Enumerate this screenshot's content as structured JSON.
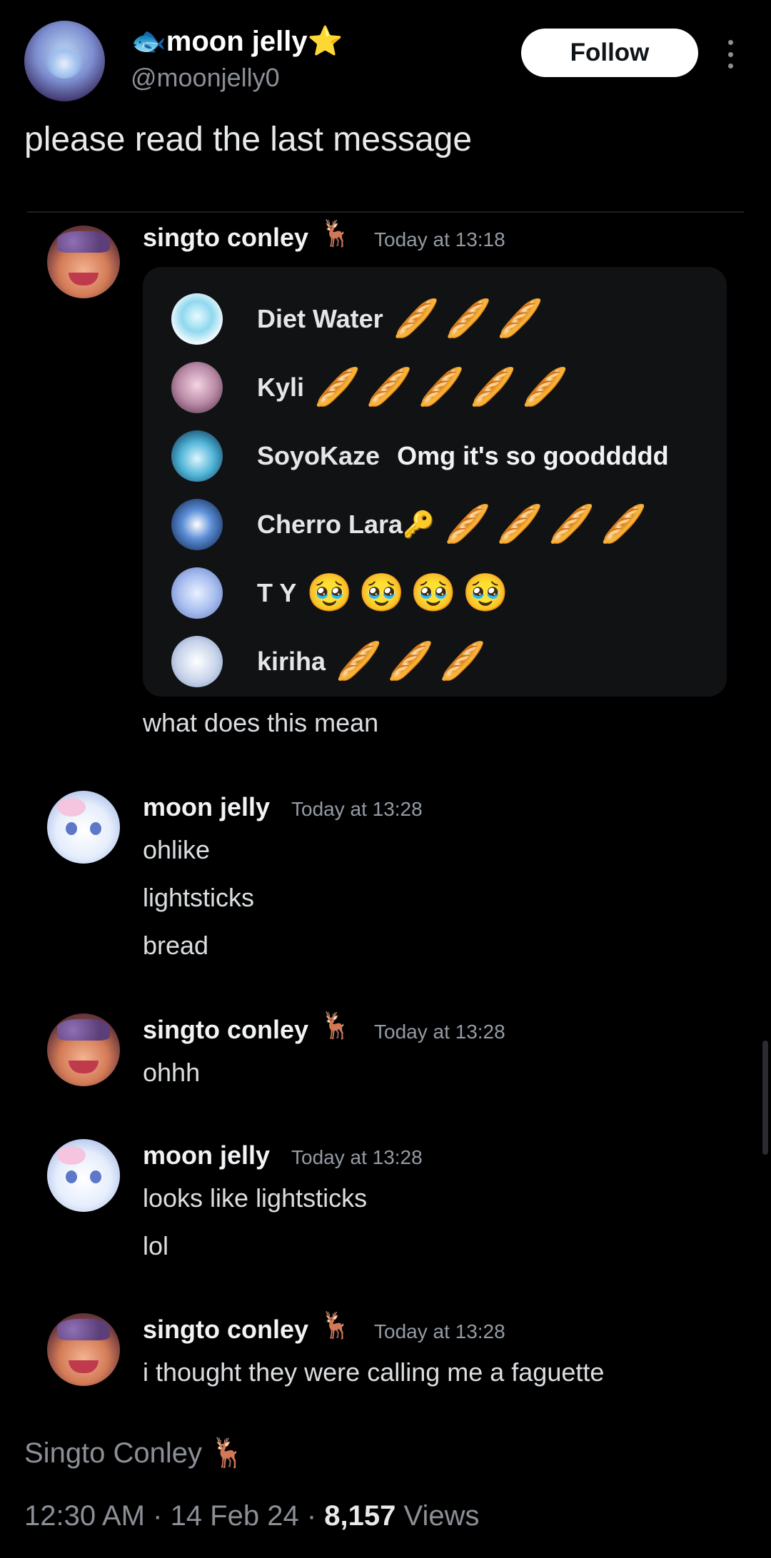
{
  "tweet": {
    "display_name": "🐟moon jelly⭐",
    "handle": "@moonjelly0",
    "follow_label": "Follow",
    "text": "please read the last message",
    "footer_name": "Singto Conley 🦌",
    "time": "12:30 AM",
    "date": "14 Feb 24",
    "views_count": "8,157",
    "views_label": "Views"
  },
  "card": {
    "rows": [
      {
        "name": "Diet Water",
        "emoji": "🥖🥖🥖"
      },
      {
        "name": "Kyli",
        "emoji": "🥖🥖🥖🥖🥖"
      },
      {
        "name": "SoyoKaze",
        "message": "Omg it's so gooddddd"
      },
      {
        "name": "Cherro Lara🔑",
        "emoji": "🥖🥖🥖🥖"
      },
      {
        "name": "T Y",
        "emoji": "🥹🥹🥹🥹"
      },
      {
        "name": "kiriha",
        "emoji": "🥖🥖🥖"
      }
    ]
  },
  "messages": [
    {
      "author": "singto conley",
      "badge": "🦌",
      "time": "Today at 13:18",
      "lines": [
        "what does this mean"
      ]
    },
    {
      "author": "moon jelly",
      "time": "Today at 13:28",
      "lines": [
        "ohlike",
        "lightsticks",
        "bread"
      ]
    },
    {
      "author": "singto conley",
      "badge": "🦌",
      "time": "Today at 13:28",
      "lines": [
        "ohhh"
      ]
    },
    {
      "author": "moon jelly",
      "time": "Today at 13:28",
      "lines": [
        "looks like lightsticks",
        "lol"
      ]
    },
    {
      "author": "singto conley",
      "badge": "🦌",
      "time": "Today at 13:28",
      "lines": [
        "i thought they were calling me a faguette"
      ]
    }
  ],
  "colors": {
    "background": "#000000",
    "muted": "#8b8f96",
    "follow_bg": "#ffffff"
  }
}
